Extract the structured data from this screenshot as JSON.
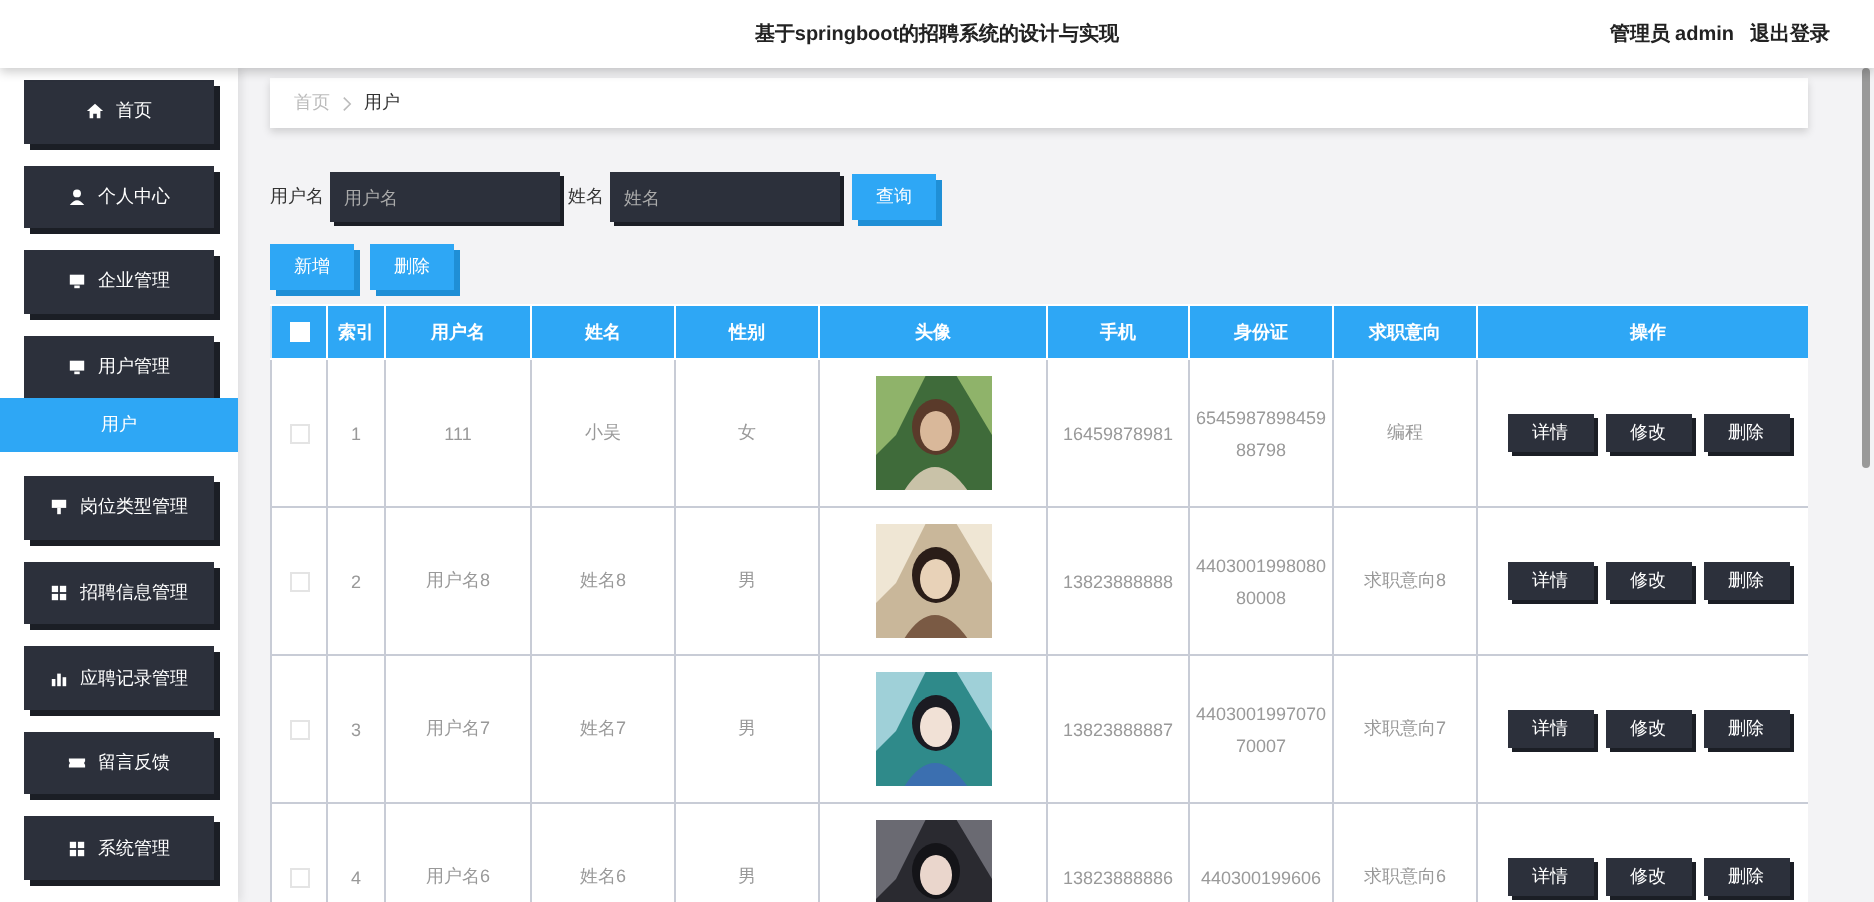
{
  "header": {
    "title": "基于springboot的招聘系统的设计与实现",
    "user": "管理员 admin",
    "logout": "退出登录"
  },
  "sidebar": {
    "items": [
      {
        "label": "首页",
        "expanded": false
      },
      {
        "label": "个人中心",
        "expanded": false
      },
      {
        "label": "企业管理",
        "expanded": false
      },
      {
        "label": "用户管理",
        "expanded": true,
        "children": [
          {
            "label": "用户",
            "selected": true
          }
        ]
      },
      {
        "label": "岗位类型管理",
        "expanded": false
      },
      {
        "label": "招聘信息管理",
        "expanded": false
      },
      {
        "label": "应聘记录管理",
        "expanded": false
      },
      {
        "label": "留言反馈",
        "expanded": false
      },
      {
        "label": "系统管理",
        "expanded": false
      }
    ]
  },
  "breadcrumb": [
    "首页",
    "用户"
  ],
  "search": {
    "fields": [
      {
        "label": "用户名",
        "placeholder": "用户名"
      },
      {
        "label": "姓名",
        "placeholder": "姓名"
      }
    ],
    "button": "查询"
  },
  "actions": [
    "新增",
    "删除"
  ],
  "table": {
    "all_checked": false,
    "columns": [
      "索引",
      "用户名",
      "姓名",
      "性别",
      "头像",
      "手机",
      "身份证",
      "求职意向",
      "操作"
    ],
    "rows": [
      {
        "checked": false,
        "cells": [
          "1",
          "111",
          "小吴",
          "女",
          {
            "kind": "picture"
          },
          "16459878981",
          "654598789845988798",
          "编程"
        ],
        "buttons": [
          "详情",
          "修改",
          "删除"
        ]
      },
      {
        "checked": false,
        "cells": [
          "2",
          "用户名8",
          "姓名8",
          "男",
          {
            "kind": "picture"
          },
          "13823888888",
          "440300199808080008",
          "求职意向8"
        ],
        "buttons": [
          "详情",
          "修改",
          "删除"
        ]
      },
      {
        "checked": false,
        "cells": [
          "3",
          "用户名7",
          "姓名7",
          "男",
          {
            "kind": "picture"
          },
          "13823888887",
          "440300199707070007",
          "求职意向7"
        ],
        "buttons": [
          "详情",
          "修改",
          "删除"
        ]
      },
      {
        "checked": false,
        "cells": [
          "4",
          "用户名6",
          "姓名6",
          "男",
          {
            "kind": "picture"
          },
          "13823888886",
          "440300199606",
          "求职意向6"
        ],
        "buttons": [
          "详情",
          "修改",
          "删除"
        ]
      }
    ]
  }
}
